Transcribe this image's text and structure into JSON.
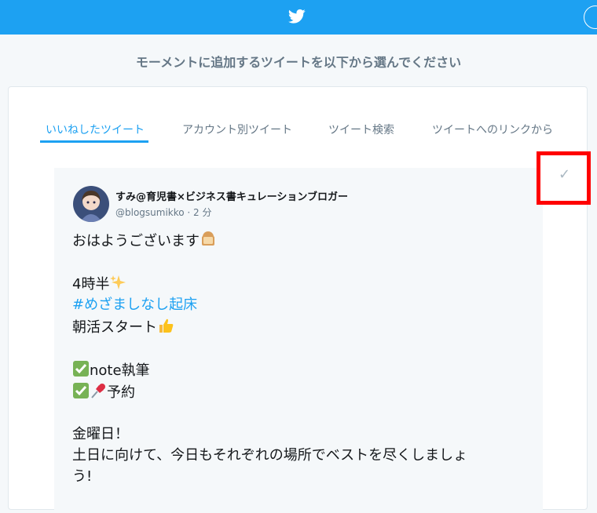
{
  "header": {
    "brand_icon": "twitter-bird-icon",
    "account_icon": "circle-icon",
    "title": "モーメントに追加するツイートを以下から選んでください"
  },
  "tabs": [
    {
      "label": "いいねしたツイート",
      "active": true
    },
    {
      "label": "アカウント別ツイート",
      "active": false
    },
    {
      "label": "ツイート検索",
      "active": false
    },
    {
      "label": "ツイートへのリンクから",
      "active": false
    }
  ],
  "tweet": {
    "author": "すみ@育児書×ビジネス書キュレーションブロガー",
    "handle_time": "@blogsumikko · 2 分",
    "lines": {
      "l1": "おはようございます",
      "l2": "4時半",
      "l3": "#めざましなし起床",
      "l4": "朝活スタート",
      "l5": "note執筆",
      "l6": "予約",
      "l7": "金曜日！",
      "l8": "土日に向けて、今日もそれぞれの場所でベストを尽くしましょ",
      "l9": "う!"
    },
    "emojis": [
      "bread-emoji",
      "sparkles-emoji",
      "thumbs-up-emoji",
      "check-box-emoji",
      "pushpin-emoji"
    ]
  },
  "select": {
    "check_icon": "checkmark-icon",
    "check_glyph": "✓",
    "highlight_color": "#ff0000"
  },
  "colors": {
    "brand": "#1da1f2",
    "text_secondary": "#657786"
  }
}
